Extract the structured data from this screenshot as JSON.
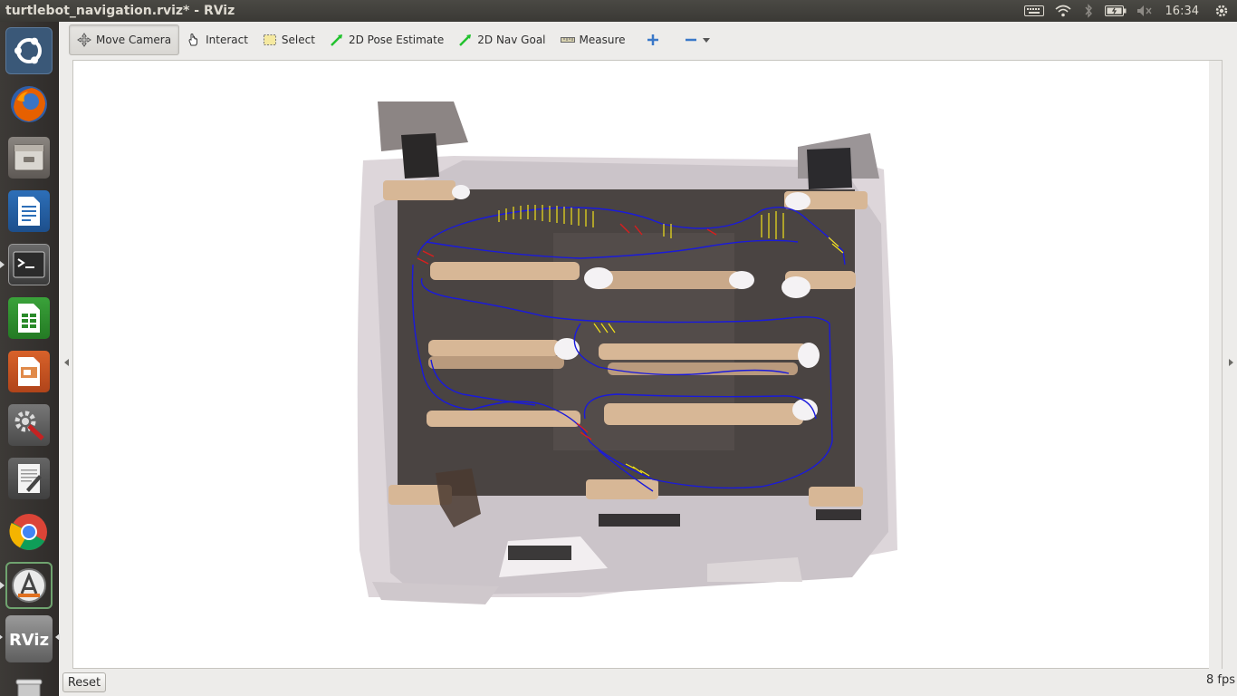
{
  "window": {
    "title": "turtlebot_navigation.rviz* - RViz"
  },
  "system_tray": {
    "clock": "16:34"
  },
  "launcher": {
    "items": [
      {
        "name": "ubuntu-dash-icon"
      },
      {
        "name": "firefox-icon"
      },
      {
        "name": "files-icon"
      },
      {
        "name": "libreoffice-writer-icon"
      },
      {
        "name": "terminal-icon"
      },
      {
        "name": "libreoffice-calc-icon"
      },
      {
        "name": "libreoffice-impress-icon"
      },
      {
        "name": "system-settings-icon"
      },
      {
        "name": "text-editor-icon"
      },
      {
        "name": "chrome-icon"
      },
      {
        "name": "software-updater-icon"
      },
      {
        "name": "rviz-icon",
        "label": "RViz"
      },
      {
        "name": "trash-icon"
      }
    ]
  },
  "toolbar": {
    "move_camera": "Move Camera",
    "interact": "Interact",
    "select": "Select",
    "pose_estimate": "2D Pose Estimate",
    "nav_goal": "2D Nav Goal",
    "measure": "Measure"
  },
  "status": {
    "reset": "Reset",
    "fps": "8 fps"
  },
  "colors": {
    "path": "#1a1adb",
    "arrows_yellow": "#f2e21a",
    "arrows_red": "#d81e1e",
    "floor": "#4a4442",
    "wall": "#c9c3c6",
    "bench": "#d7b796"
  }
}
